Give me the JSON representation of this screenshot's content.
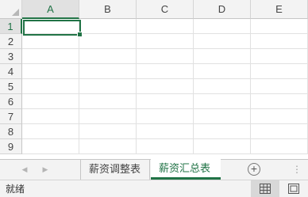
{
  "sheet": {
    "columns": [
      "A",
      "B",
      "C",
      "D",
      "E"
    ],
    "rows": [
      "1",
      "2",
      "3",
      "4",
      "5",
      "6",
      "7",
      "8",
      "9"
    ],
    "active_cell": "A1"
  },
  "tabs": {
    "items": [
      {
        "label": "薪资调整表",
        "active": false
      },
      {
        "label": "薪资汇总表",
        "active": true
      }
    ],
    "add_sheet_icon": "plus-circle-icon",
    "more_icon": "vertical-ellipsis-icon",
    "prev_icon": "triangle-left-icon",
    "next_icon": "triangle-right-icon"
  },
  "status": {
    "text": "就绪",
    "views": [
      "normal-view-icon",
      "page-layout-view-icon"
    ]
  },
  "colors": {
    "accent": "#217346",
    "header_bg": "#f3f3f3",
    "gridline": "#e1e1e1"
  }
}
